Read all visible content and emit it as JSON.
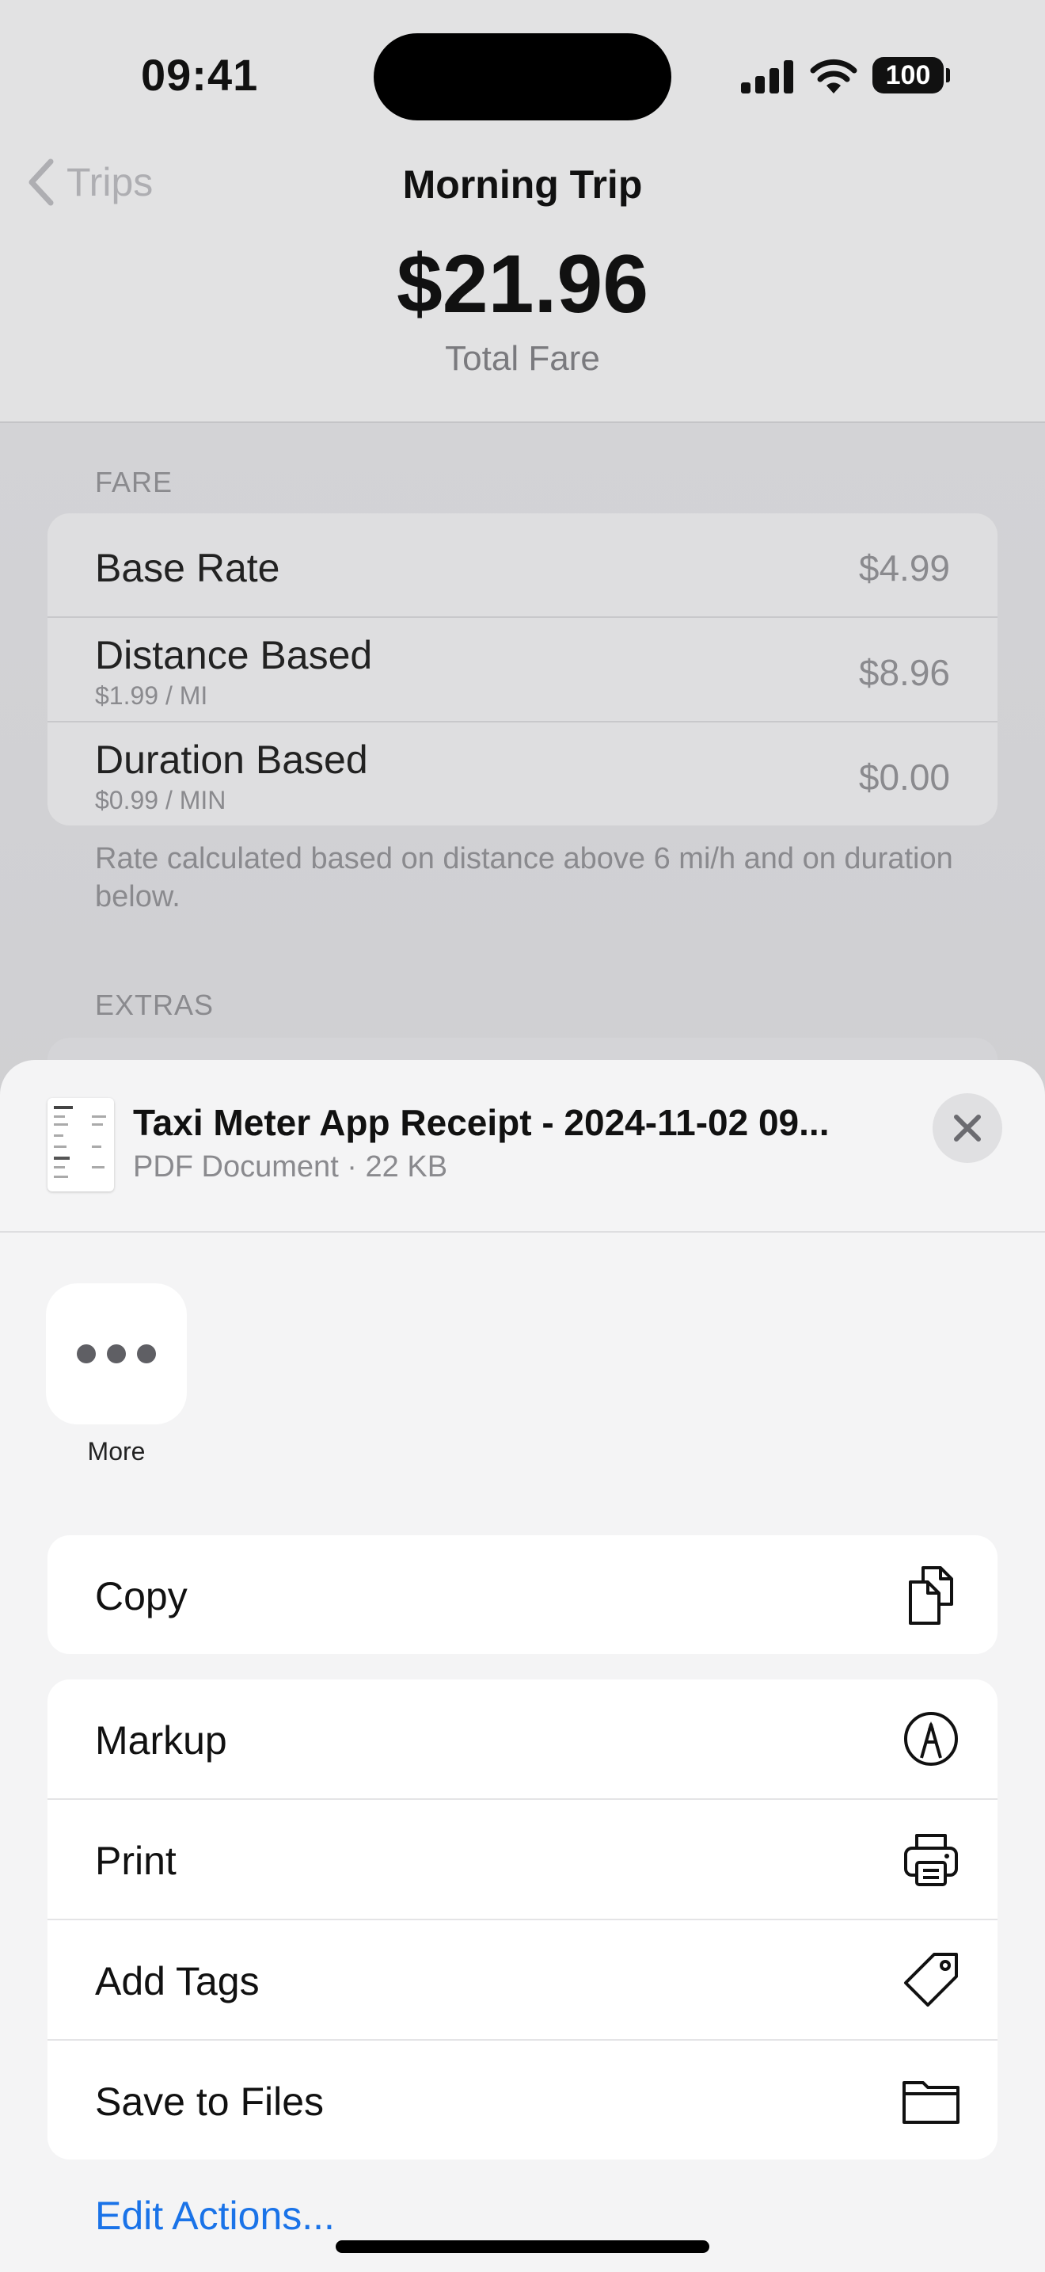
{
  "status_bar": {
    "time": "09:41",
    "battery": "100"
  },
  "nav": {
    "back_label": "Trips",
    "title": "Morning Trip"
  },
  "fare_summary": {
    "total": "$21.96",
    "total_label": "Total Fare"
  },
  "fare_section": {
    "header": "FARE",
    "rows": [
      {
        "label": "Base Rate",
        "sub": "",
        "value": "$4.99"
      },
      {
        "label": "Distance Based",
        "sub": "$1.99 / MI",
        "value": "$8.96"
      },
      {
        "label": "Duration Based",
        "sub": "$0.99 / MIN",
        "value": "$0.00"
      }
    ],
    "footnote": "Rate calculated based on distance above 6 mi/h and on duration below."
  },
  "extras_section": {
    "header": "EXTRAS"
  },
  "share_sheet": {
    "file_name": "Taxi Meter App Receipt - 2024-11-02 09...",
    "file_meta": "PDF Document · 22 KB",
    "more_label": "More",
    "actions_group1": [
      {
        "label": "Copy",
        "icon": "copy-icon"
      }
    ],
    "actions_group2": [
      {
        "label": "Markup",
        "icon": "markup-icon"
      },
      {
        "label": "Print",
        "icon": "printer-icon"
      },
      {
        "label": "Add Tags",
        "icon": "tag-icon"
      },
      {
        "label": "Save to Files",
        "icon": "folder-icon"
      }
    ],
    "edit_actions": "Edit Actions..."
  }
}
